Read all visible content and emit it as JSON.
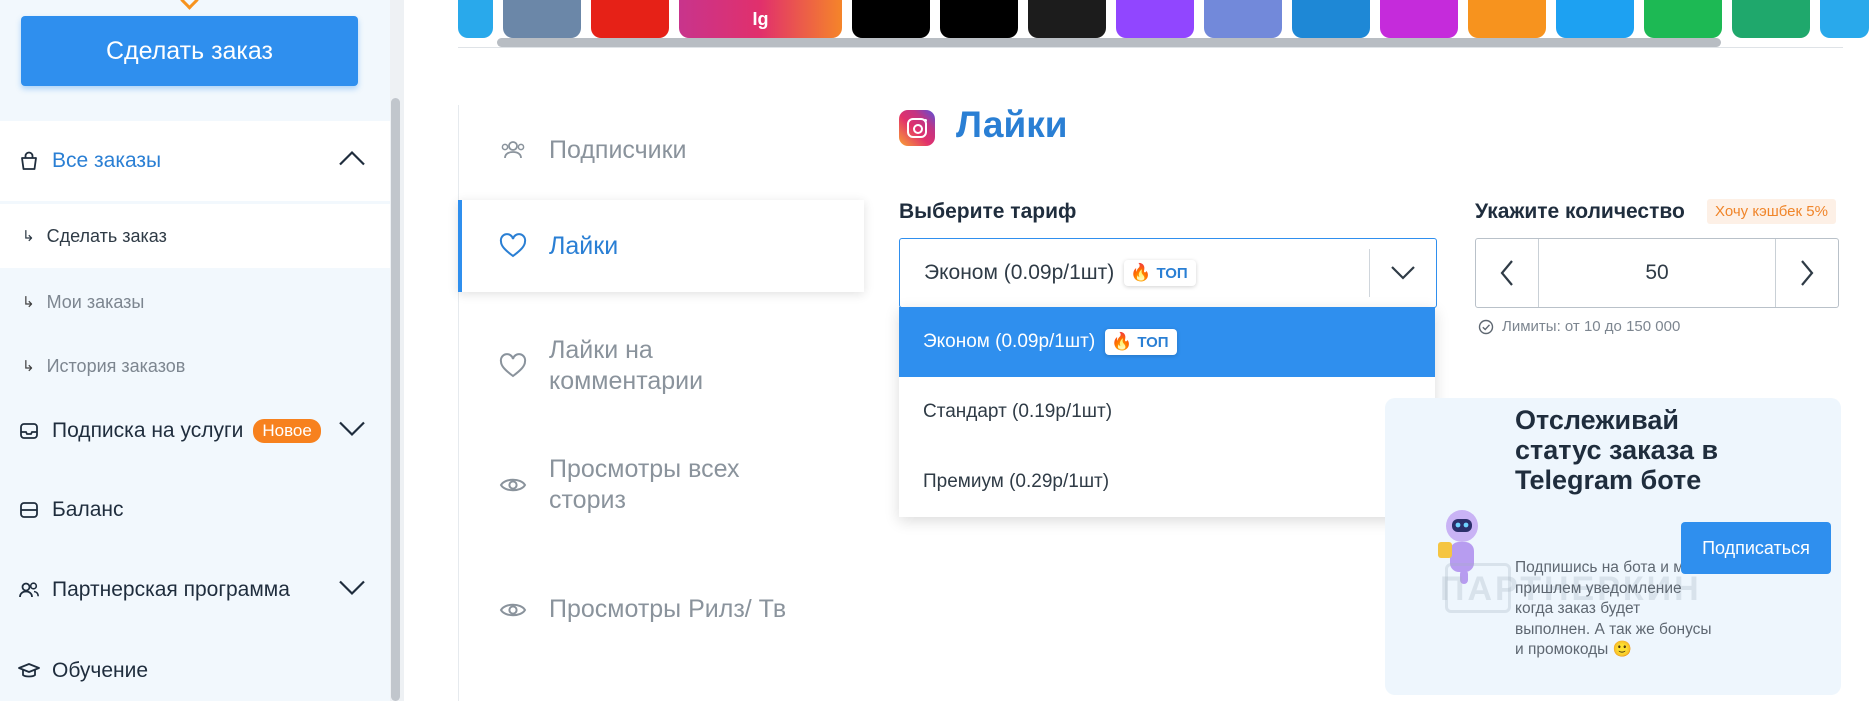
{
  "sidebar": {
    "order_button": "Сделать заказ",
    "all_orders": "Все заказы",
    "sub_items": [
      "Сделать заказ",
      "Мои заказы",
      "История заказов"
    ],
    "subscription": "Подписка на услуги",
    "new_badge": "Новое",
    "balance": "Баланс",
    "partner": "Партнерская программа",
    "learning": "Обучение"
  },
  "social_tabs": {
    "items": [
      "telegram",
      "vk",
      "youtube",
      "instagram",
      "tiktok-alt",
      "tiktok",
      "kinopoisk",
      "twitch",
      "discord",
      "likee",
      "yandex-zen",
      "ok",
      "twitter",
      "spotify",
      "threads",
      "telegram-alt"
    ],
    "colors": [
      "#29a9eb",
      "#6b87a8",
      "#e62117",
      "#c8348c",
      "#000000",
      "#000000",
      "#1c1c1c",
      "#9146ff",
      "#7289da",
      "#1e88d6",
      "#c52bdb",
      "#f7931e",
      "#1da1f2",
      "#1db954",
      "#1fa86c",
      "#29a9eb"
    ],
    "ig_text": "Ig"
  },
  "services": [
    "Подписчики",
    "Лайки",
    "Лайки на комментарии",
    "Просмотры всех сториз",
    "Просмотры Рилз/ Тв"
  ],
  "main": {
    "title": "Лайки",
    "tariff_label": "Выберите тариф",
    "tariff_selected": "Эконом (0.09р/1шт)",
    "top_badge": "ТОП",
    "options": [
      "Эконом (0.09р/1шт)",
      "Стандарт (0.19р/1шт)",
      "Премиум (0.29р/1шт)"
    ],
    "qty_label": "Укажите количество",
    "cashback": "Хочу кэшбек 5%",
    "qty_value": "50",
    "limits": "Лимиты: от 10 до 150 000"
  },
  "promo": {
    "title": "Отслеживай статус заказа в Telegram боте",
    "text": "Подпишись на бота и мы пришлем уведомление когда заказ будет выполнен. А так же бонусы и промокоды 🙂",
    "button": "Подписаться",
    "watermark": "ПАРТНЕРКИН"
  },
  "colors": {
    "accent": "#2f8fee",
    "link": "#2a7fd4",
    "orange": "#f7811e",
    "sidebar_bg": "#f2f8fd"
  }
}
